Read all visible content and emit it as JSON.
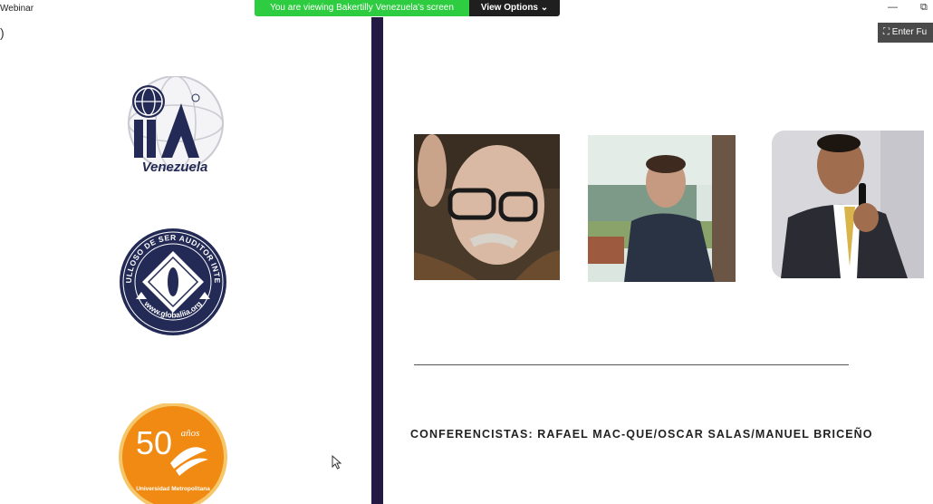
{
  "window": {
    "title": "Webinar"
  },
  "share_banner": {
    "text": "You are viewing Bakertilly Venezuela's screen"
  },
  "view_options": {
    "label": "View Options ⌄"
  },
  "window_controls": {
    "minimize": "—",
    "restore": "⧉"
  },
  "enter_full": {
    "label": "Enter Fu"
  },
  "slide": {
    "logos": [
      {
        "name": "IIA",
        "caption": "Venezuela"
      },
      {
        "name": "seal",
        "top_text": "ORGULLOSO DE SER AUDITOR INTERNO",
        "bottom_text": "www.globaliia.org"
      },
      {
        "name": "50 años",
        "number": "50",
        "suffix": "años",
        "caption": "Universidad Metropolitana"
      }
    ],
    "speakers_text": "CONFERENCISTAS: RAFAEL MAC-QUE/OSCAR SALAS/MANUEL BRICEÑO"
  },
  "colors": {
    "banner": "#2ecc40",
    "divider": "#241a44",
    "navy": "#232a55",
    "orange": "#f08a12"
  }
}
